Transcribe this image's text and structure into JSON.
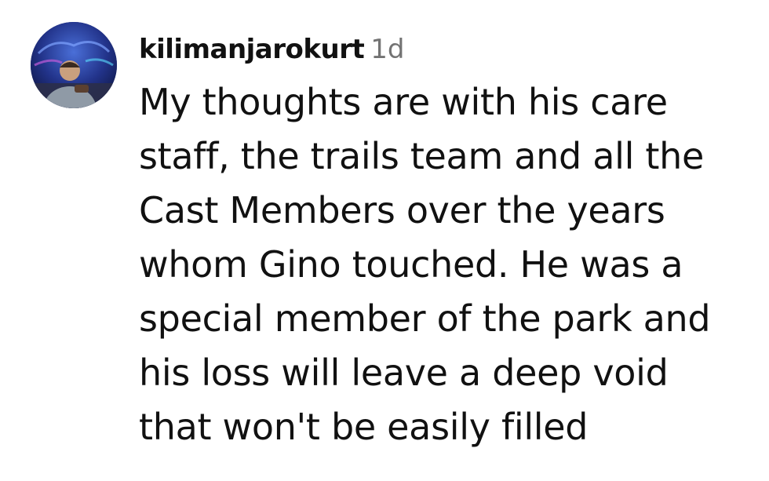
{
  "comment": {
    "username": "kilimanjarokurt",
    "timestamp": "1d",
    "avatar_icon": "user-avatar-photo",
    "lines": [
      "My thoughts are with his care",
      "staff, the trails team and all the",
      "Cast Members over the years",
      "whom Gino touched. He was a",
      "special member of the park and",
      "his loss will leave a deep void",
      "that won't be easily filled"
    ]
  },
  "colors": {
    "text": "#111111",
    "timestamp": "#737373",
    "background": "#ffffff"
  }
}
